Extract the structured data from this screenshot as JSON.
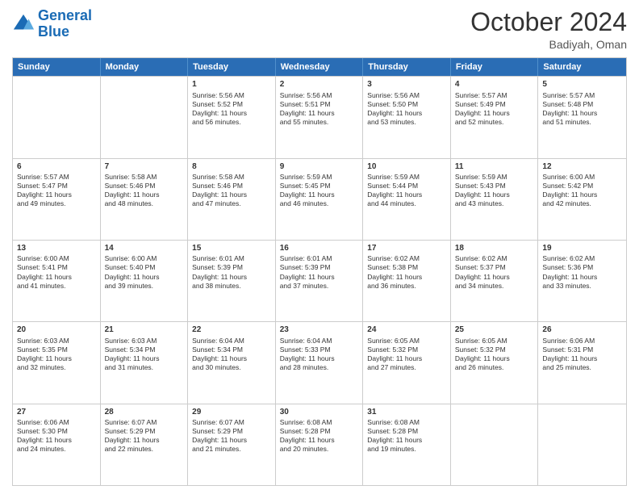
{
  "header": {
    "logo_line1": "General",
    "logo_line2": "Blue",
    "month": "October 2024",
    "location": "Badiyah, Oman"
  },
  "days_of_week": [
    "Sunday",
    "Monday",
    "Tuesday",
    "Wednesday",
    "Thursday",
    "Friday",
    "Saturday"
  ],
  "weeks": [
    [
      {
        "day": "",
        "lines": []
      },
      {
        "day": "",
        "lines": []
      },
      {
        "day": "1",
        "lines": [
          "Sunrise: 5:56 AM",
          "Sunset: 5:52 PM",
          "Daylight: 11 hours",
          "and 56 minutes."
        ]
      },
      {
        "day": "2",
        "lines": [
          "Sunrise: 5:56 AM",
          "Sunset: 5:51 PM",
          "Daylight: 11 hours",
          "and 55 minutes."
        ]
      },
      {
        "day": "3",
        "lines": [
          "Sunrise: 5:56 AM",
          "Sunset: 5:50 PM",
          "Daylight: 11 hours",
          "and 53 minutes."
        ]
      },
      {
        "day": "4",
        "lines": [
          "Sunrise: 5:57 AM",
          "Sunset: 5:49 PM",
          "Daylight: 11 hours",
          "and 52 minutes."
        ]
      },
      {
        "day": "5",
        "lines": [
          "Sunrise: 5:57 AM",
          "Sunset: 5:48 PM",
          "Daylight: 11 hours",
          "and 51 minutes."
        ]
      }
    ],
    [
      {
        "day": "6",
        "lines": [
          "Sunrise: 5:57 AM",
          "Sunset: 5:47 PM",
          "Daylight: 11 hours",
          "and 49 minutes."
        ]
      },
      {
        "day": "7",
        "lines": [
          "Sunrise: 5:58 AM",
          "Sunset: 5:46 PM",
          "Daylight: 11 hours",
          "and 48 minutes."
        ]
      },
      {
        "day": "8",
        "lines": [
          "Sunrise: 5:58 AM",
          "Sunset: 5:46 PM",
          "Daylight: 11 hours",
          "and 47 minutes."
        ]
      },
      {
        "day": "9",
        "lines": [
          "Sunrise: 5:59 AM",
          "Sunset: 5:45 PM",
          "Daylight: 11 hours",
          "and 46 minutes."
        ]
      },
      {
        "day": "10",
        "lines": [
          "Sunrise: 5:59 AM",
          "Sunset: 5:44 PM",
          "Daylight: 11 hours",
          "and 44 minutes."
        ]
      },
      {
        "day": "11",
        "lines": [
          "Sunrise: 5:59 AM",
          "Sunset: 5:43 PM",
          "Daylight: 11 hours",
          "and 43 minutes."
        ]
      },
      {
        "day": "12",
        "lines": [
          "Sunrise: 6:00 AM",
          "Sunset: 5:42 PM",
          "Daylight: 11 hours",
          "and 42 minutes."
        ]
      }
    ],
    [
      {
        "day": "13",
        "lines": [
          "Sunrise: 6:00 AM",
          "Sunset: 5:41 PM",
          "Daylight: 11 hours",
          "and 41 minutes."
        ]
      },
      {
        "day": "14",
        "lines": [
          "Sunrise: 6:00 AM",
          "Sunset: 5:40 PM",
          "Daylight: 11 hours",
          "and 39 minutes."
        ]
      },
      {
        "day": "15",
        "lines": [
          "Sunrise: 6:01 AM",
          "Sunset: 5:39 PM",
          "Daylight: 11 hours",
          "and 38 minutes."
        ]
      },
      {
        "day": "16",
        "lines": [
          "Sunrise: 6:01 AM",
          "Sunset: 5:39 PM",
          "Daylight: 11 hours",
          "and 37 minutes."
        ]
      },
      {
        "day": "17",
        "lines": [
          "Sunrise: 6:02 AM",
          "Sunset: 5:38 PM",
          "Daylight: 11 hours",
          "and 36 minutes."
        ]
      },
      {
        "day": "18",
        "lines": [
          "Sunrise: 6:02 AM",
          "Sunset: 5:37 PM",
          "Daylight: 11 hours",
          "and 34 minutes."
        ]
      },
      {
        "day": "19",
        "lines": [
          "Sunrise: 6:02 AM",
          "Sunset: 5:36 PM",
          "Daylight: 11 hours",
          "and 33 minutes."
        ]
      }
    ],
    [
      {
        "day": "20",
        "lines": [
          "Sunrise: 6:03 AM",
          "Sunset: 5:35 PM",
          "Daylight: 11 hours",
          "and 32 minutes."
        ]
      },
      {
        "day": "21",
        "lines": [
          "Sunrise: 6:03 AM",
          "Sunset: 5:34 PM",
          "Daylight: 11 hours",
          "and 31 minutes."
        ]
      },
      {
        "day": "22",
        "lines": [
          "Sunrise: 6:04 AM",
          "Sunset: 5:34 PM",
          "Daylight: 11 hours",
          "and 30 minutes."
        ]
      },
      {
        "day": "23",
        "lines": [
          "Sunrise: 6:04 AM",
          "Sunset: 5:33 PM",
          "Daylight: 11 hours",
          "and 28 minutes."
        ]
      },
      {
        "day": "24",
        "lines": [
          "Sunrise: 6:05 AM",
          "Sunset: 5:32 PM",
          "Daylight: 11 hours",
          "and 27 minutes."
        ]
      },
      {
        "day": "25",
        "lines": [
          "Sunrise: 6:05 AM",
          "Sunset: 5:32 PM",
          "Daylight: 11 hours",
          "and 26 minutes."
        ]
      },
      {
        "day": "26",
        "lines": [
          "Sunrise: 6:06 AM",
          "Sunset: 5:31 PM",
          "Daylight: 11 hours",
          "and 25 minutes."
        ]
      }
    ],
    [
      {
        "day": "27",
        "lines": [
          "Sunrise: 6:06 AM",
          "Sunset: 5:30 PM",
          "Daylight: 11 hours",
          "and 24 minutes."
        ]
      },
      {
        "day": "28",
        "lines": [
          "Sunrise: 6:07 AM",
          "Sunset: 5:29 PM",
          "Daylight: 11 hours",
          "and 22 minutes."
        ]
      },
      {
        "day": "29",
        "lines": [
          "Sunrise: 6:07 AM",
          "Sunset: 5:29 PM",
          "Daylight: 11 hours",
          "and 21 minutes."
        ]
      },
      {
        "day": "30",
        "lines": [
          "Sunrise: 6:08 AM",
          "Sunset: 5:28 PM",
          "Daylight: 11 hours",
          "and 20 minutes."
        ]
      },
      {
        "day": "31",
        "lines": [
          "Sunrise: 6:08 AM",
          "Sunset: 5:28 PM",
          "Daylight: 11 hours",
          "and 19 minutes."
        ]
      },
      {
        "day": "",
        "lines": []
      },
      {
        "day": "",
        "lines": []
      }
    ]
  ]
}
